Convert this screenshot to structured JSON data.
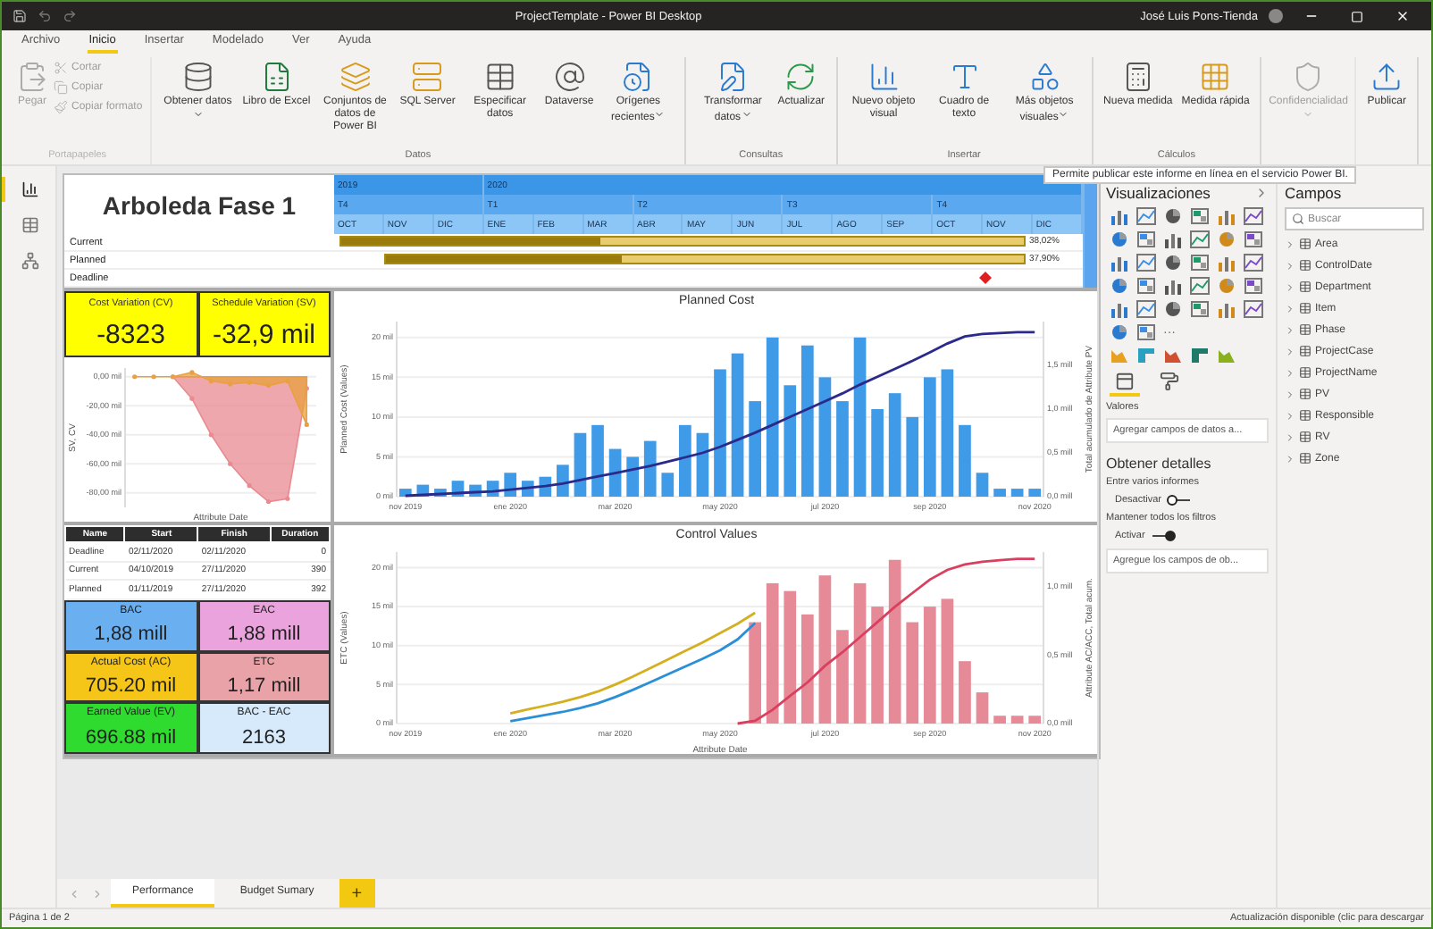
{
  "window": {
    "title": "ProjectTemplate - Power BI Desktop",
    "user": "José Luis Pons-Tienda"
  },
  "menu": [
    {
      "label": "Archivo",
      "selected": false
    },
    {
      "label": "Inicio",
      "selected": true
    },
    {
      "label": "Insertar",
      "selected": false
    },
    {
      "label": "Modelado",
      "selected": false
    },
    {
      "label": "Ver",
      "selected": false
    },
    {
      "label": "Ayuda",
      "selected": false
    }
  ],
  "ribbon": [
    {
      "label": "Portapapeles",
      "disabled": true,
      "items": [
        {
          "label": "Pegar",
          "kind": "large",
          "dropdown": false
        },
        {
          "label": "Cortar",
          "kind": "small",
          "dropdown": false
        },
        {
          "label": "Copiar",
          "kind": "small",
          "dropdown": false
        },
        {
          "label": "Copiar formato",
          "kind": "small",
          "dropdown": false
        }
      ]
    },
    {
      "label": "Datos",
      "disabled": false,
      "items": [
        {
          "label": "Obtener datos",
          "kind": "large",
          "dropdown": true
        },
        {
          "label": "Libro de Excel",
          "kind": "large",
          "dropdown": false
        },
        {
          "label": "Conjuntos de datos de Power BI",
          "kind": "large",
          "dropdown": false
        },
        {
          "label": "SQL Server",
          "kind": "large",
          "dropdown": false
        },
        {
          "label": "Especificar datos",
          "kind": "large",
          "dropdown": false
        },
        {
          "label": "Dataverse",
          "kind": "large",
          "dropdown": false
        },
        {
          "label": "Orígenes recientes",
          "kind": "large",
          "dropdown": true
        }
      ]
    },
    {
      "label": "Consultas",
      "disabled": false,
      "items": [
        {
          "label": "Transformar datos",
          "kind": "large",
          "dropdown": true
        },
        {
          "label": "Actualizar",
          "kind": "large",
          "dropdown": false
        }
      ]
    },
    {
      "label": "Insertar",
      "disabled": false,
      "items": [
        {
          "label": "Nuevo objeto visual",
          "kind": "large",
          "dropdown": false
        },
        {
          "label": "Cuadro de texto",
          "kind": "large",
          "dropdown": false
        },
        {
          "label": "Más objetos visuales",
          "kind": "large",
          "dropdown": true
        }
      ]
    },
    {
      "label": "Cálculos",
      "disabled": false,
      "items": [
        {
          "label": "Nueva medida",
          "kind": "large",
          "dropdown": false
        },
        {
          "label": "Medida rápida",
          "kind": "large",
          "dropdown": false
        }
      ]
    },
    {
      "disabled": true,
      "items": [
        {
          "label": "Confidencialidad",
          "kind": "large",
          "dropdown": true
        }
      ]
    },
    {
      "disabled": false,
      "items": [
        {
          "label": "Publicar",
          "kind": "large",
          "dropdown": false
        }
      ]
    }
  ],
  "tooltip": "Permite publicar este informe en línea en el servicio Power BI.",
  "nav": [
    {
      "selected": true
    },
    {
      "selected": false
    },
    {
      "selected": false
    }
  ],
  "report": {
    "title": "Arboleda Fase 1",
    "gantt": {
      "years": [
        "2019",
        "2020"
      ],
      "quarters": [
        "T4",
        "T1",
        "T2",
        "T3",
        "T4"
      ],
      "months": [
        "OCT",
        "NOV",
        "DIC",
        "ENE",
        "FEB",
        "MAR",
        "ABR",
        "MAY",
        "JUN",
        "JUL",
        "AGO",
        "SEP",
        "OCT",
        "NOV",
        "DIC"
      ],
      "rows": [
        {
          "label": "Current",
          "kind": "task",
          "level": 0.38,
          "reading": "38,02%"
        },
        {
          "label": "Planned",
          "kind": "task",
          "level": 0.37,
          "reading": "37,90%"
        },
        {
          "label": "Deadline",
          "kind": "milestone"
        }
      ]
    },
    "kpis": [
      {
        "label": "Cost Variation (CV)",
        "value": "-8323"
      },
      {
        "label": "Schedule Variation (SV)",
        "value": "-32,9 mil"
      }
    ],
    "variation_chart": {
      "chart_data": {
        "type": "area",
        "grid": true,
        "xlabel": "Attribute Date",
        "ylabel": "SV, CV",
        "categories": [
          null,
          null,
          null,
          null,
          null,
          null,
          null,
          null,
          null,
          null
        ],
        "ylim": [
          -90,
          6
        ],
        "yticks": [
          {
            "value": 0,
            "label": "0,00 mil"
          },
          {
            "value": -20,
            "label": "-20,00 mil"
          },
          {
            "value": -40,
            "label": "-40,00 mil"
          },
          {
            "value": -60,
            "label": "-60,00 mil"
          },
          {
            "value": -80,
            "label": "-80,00 mil"
          }
        ],
        "series": [
          {
            "color": "#e88a90",
            "values": [
              null,
              null,
              0,
              -15,
              -40,
              -60,
              -75,
              -86,
              -84,
              -8
            ]
          },
          {
            "color": "#e8a040",
            "values": [
              0,
              0,
              0,
              3,
              -3,
              -5,
              -4,
              -6,
              -3,
              -33
            ]
          }
        ]
      }
    },
    "dates_table": {
      "columns": [
        "Name",
        "Start",
        "Finish",
        "Duration"
      ],
      "rows": [
        [
          "Deadline",
          "02/11/2020",
          "02/11/2020",
          "0"
        ],
        [
          "Current",
          "04/10/2019",
          "27/11/2020",
          "390"
        ],
        [
          "Planned",
          "01/11/2019",
          "27/11/2020",
          "392"
        ]
      ]
    },
    "cards": [
      {
        "label": "BAC",
        "value": "1,88 mill",
        "color": "#6aaff0"
      },
      {
        "label": "EAC",
        "value": "1,88 mill",
        "color": "#eaa3dc"
      },
      {
        "label": "Actual Cost (AC)",
        "value": "705.20 mil",
        "color": "#f5c518"
      },
      {
        "label": "ETC",
        "value": "1,17 mill",
        "color": "#e9a3a8"
      },
      {
        "label": "Earned Value (EV)",
        "value": "696.88 mil",
        "color": "#2edb2e"
      },
      {
        "label": "BAC - EAC",
        "value": "2163",
        "color": "#d6eafb"
      }
    ],
    "planned_cost": {
      "chart_data": {
        "type": "bar",
        "grid": true,
        "title": "Planned Cost",
        "ylabel": "Planned Cost (Values)",
        "y2label": "Total acumulado de Attribute PV",
        "categories": [
          "nov 2019",
          null,
          null,
          null,
          null,
          null,
          "ene 2020",
          null,
          null,
          null,
          null,
          null,
          "mar 2020",
          null,
          null,
          null,
          null,
          null,
          "may 2020",
          null,
          null,
          null,
          null,
          null,
          "jul 2020",
          null,
          null,
          null,
          null,
          null,
          "sep 2020",
          null,
          null,
          null,
          null,
          null,
          "nov 2020"
        ],
        "ylim": [
          0,
          22
        ],
        "y2lim": [
          0,
          2
        ],
        "yticks": [
          {
            "value": 0,
            "label": "0 mil"
          },
          {
            "value": 5,
            "label": "5 mil"
          },
          {
            "value": 10,
            "label": "10 mil"
          },
          {
            "value": 15,
            "label": "15 mil"
          },
          {
            "value": 20,
            "label": "20 mil"
          }
        ],
        "y2ticks": [
          {
            "value": 0,
            "label": "0,0 mill"
          },
          {
            "value": 0.5,
            "label": "0,5 mill"
          },
          {
            "value": 1,
            "label": "1,0 mill"
          },
          {
            "value": 1.5,
            "label": "1,5 mill"
          }
        ],
        "series": [
          {
            "axis": "y",
            "color": "#3f9ae8",
            "values": [
              1,
              1.5,
              1,
              2,
              1.5,
              2,
              3,
              2,
              2.5,
              4,
              8,
              9,
              6,
              5,
              7,
              3,
              9,
              8,
              16,
              18,
              12,
              20,
              14,
              19,
              15,
              12,
              20,
              11,
              13,
              10,
              15,
              16,
              9,
              3,
              1,
              1,
              1
            ]
          },
          {
            "type": "line",
            "axis": "y2",
            "color": "#2b2a8a",
            "values": [
              0.01,
              0.02,
              0.03,
              0.04,
              0.05,
              0.06,
              0.08,
              0.1,
              0.12,
              0.15,
              0.19,
              0.23,
              0.27,
              0.31,
              0.35,
              0.4,
              0.45,
              0.5,
              0.57,
              0.65,
              0.73,
              0.82,
              0.91,
              1.0,
              1.09,
              1.18,
              1.28,
              1.37,
              1.46,
              1.55,
              1.65,
              1.75,
              1.83,
              1.86,
              1.87,
              1.88,
              1.88
            ]
          }
        ]
      }
    },
    "control_values": {
      "chart_data": {
        "type": "bar",
        "grid": true,
        "title": "Control Values",
        "xlabel": "Attribute Date",
        "ylabel": "ETC (Values)",
        "y2label": "Attribute AC/ACC, Total acum.",
        "categories": [
          "nov 2019",
          null,
          null,
          null,
          null,
          null,
          "ene 2020",
          null,
          null,
          null,
          null,
          null,
          "mar 2020",
          null,
          null,
          null,
          null,
          null,
          "may 2020",
          null,
          null,
          null,
          null,
          null,
          "jul 2020",
          null,
          null,
          null,
          null,
          null,
          "sep 2020",
          null,
          null,
          null,
          null,
          null,
          "nov 2020"
        ],
        "ylim": [
          0,
          22
        ],
        "y2lim": [
          0,
          1.25
        ],
        "yticks": [
          {
            "value": 0,
            "label": "0 mil"
          },
          {
            "value": 5,
            "label": "5 mil"
          },
          {
            "value": 10,
            "label": "10 mil"
          },
          {
            "value": 15,
            "label": "15 mil"
          },
          {
            "value": 20,
            "label": "20 mil"
          }
        ],
        "y2ticks": [
          {
            "value": 0,
            "label": "0,0 mill"
          },
          {
            "value": 0.5,
            "label": "0,5 mill"
          },
          {
            "value": 1,
            "label": "1,0 mill"
          }
        ],
        "series": [
          {
            "axis": "y",
            "color": "#e58a96",
            "values": [
              null,
              null,
              null,
              null,
              null,
              null,
              null,
              null,
              null,
              null,
              null,
              null,
              null,
              null,
              null,
              null,
              null,
              null,
              null,
              null,
              13,
              18,
              17,
              14,
              19,
              12,
              18,
              15,
              21,
              13,
              15,
              16,
              8,
              4,
              1,
              1,
              1
            ]
          },
          {
            "type": "line",
            "axis": "y",
            "color": "#d4b020",
            "values": [
              null,
              null,
              null,
              null,
              null,
              null,
              1.3,
              1.8,
              2.3,
              2.8,
              3.4,
              4.1,
              5,
              6,
              7.1,
              8.2,
              9.3,
              10.4,
              11.6,
              12.8,
              14.2,
              null,
              null,
              null,
              null,
              null,
              null,
              null,
              null,
              null,
              null,
              null,
              null,
              null,
              null,
              null,
              null
            ]
          },
          {
            "type": "line",
            "axis": "y",
            "color": "#2a8fd6",
            "values": [
              null,
              null,
              null,
              null,
              null,
              null,
              0.3,
              0.7,
              1.1,
              1.5,
              2,
              2.6,
              3.4,
              4.3,
              5.3,
              6.3,
              7.3,
              8.3,
              9.4,
              10.8,
              12.9,
              null,
              null,
              null,
              null,
              null,
              null,
              null,
              null,
              null,
              null,
              null,
              null,
              null,
              null,
              null,
              null
            ]
          },
          {
            "type": "line",
            "axis": "y2",
            "color": "#d94060",
            "values": [
              null,
              null,
              null,
              null,
              null,
              null,
              null,
              null,
              null,
              null,
              null,
              null,
              null,
              null,
              null,
              null,
              null,
              null,
              null,
              0,
              0.02,
              0.1,
              0.2,
              0.3,
              0.42,
              0.52,
              0.63,
              0.74,
              0.85,
              0.95,
              1.05,
              1.12,
              1.16,
              1.18,
              1.19,
              1.2,
              1.2
            ]
          }
        ]
      }
    }
  },
  "visualizations": {
    "title": "Visualizaciones",
    "more": "···",
    "pane_tabs": [
      {
        "selected": true
      },
      {
        "selected": false
      }
    ],
    "well": {
      "label": "Valores",
      "placeholder": "Agregar campos de datos a..."
    },
    "drillthrough": {
      "title": "Obtener detalles",
      "options": [
        {
          "label": "Entre varios informes",
          "toggle": "Desactivar",
          "on": false
        },
        {
          "label": "Mantener todos los filtros",
          "toggle": "Activar",
          "on": true
        }
      ],
      "placeholder": "Agregue los campos de ob..."
    }
  },
  "fields": {
    "title": "Campos",
    "search_placeholder": "Buscar",
    "tables": [
      {
        "name": "Area",
        "expanded": false
      },
      {
        "name": "ControlDate",
        "expanded": false
      },
      {
        "name": "Department",
        "expanded": false
      },
      {
        "name": "Item",
        "expanded": false
      },
      {
        "name": "Phase",
        "expanded": false
      },
      {
        "name": "ProjectCase",
        "expanded": false
      },
      {
        "name": "ProjectName",
        "expanded": false
      },
      {
        "name": "PV",
        "expanded": false
      },
      {
        "name": "Responsible",
        "expanded": false
      },
      {
        "name": "RV",
        "expanded": false
      },
      {
        "name": "Zone",
        "expanded": false
      }
    ]
  },
  "pages": [
    {
      "label": "Performance",
      "selected": true
    },
    {
      "label": "Budget Sumary",
      "selected": false
    }
  ],
  "add_page": "+",
  "status": {
    "page": "Página 1 de 2",
    "update": "Actualización disponible (clic para descargar"
  }
}
